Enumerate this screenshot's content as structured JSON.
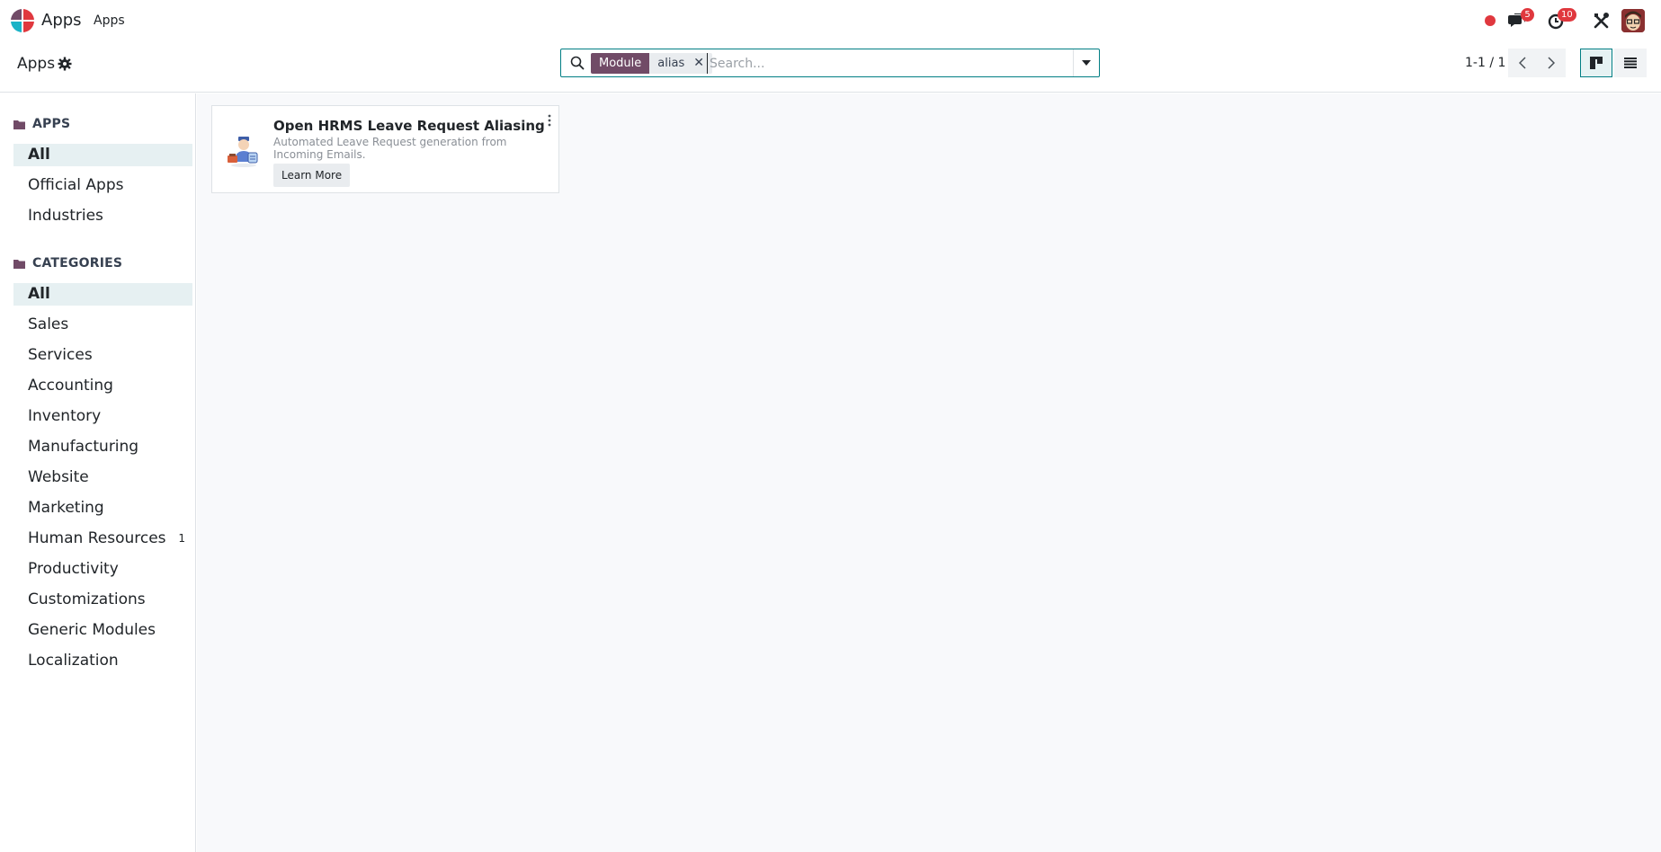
{
  "navbar": {
    "app_title": "Apps",
    "menu_apps": "Apps",
    "messages_count": "5",
    "activities_count": "10"
  },
  "control_panel": {
    "breadcrumb": "Apps",
    "search": {
      "facet_label": "Module",
      "facet_value": "alias",
      "placeholder": "Search..."
    },
    "pager": "1-1 / 1"
  },
  "sidebar": {
    "apps_header": "APPS",
    "apps_items": [
      {
        "label": "All"
      },
      {
        "label": "Official Apps"
      },
      {
        "label": "Industries"
      }
    ],
    "categories_header": "CATEGORIES",
    "category_items": [
      {
        "label": "All"
      },
      {
        "label": "Sales"
      },
      {
        "label": "Services"
      },
      {
        "label": "Accounting"
      },
      {
        "label": "Inventory"
      },
      {
        "label": "Manufacturing"
      },
      {
        "label": "Website"
      },
      {
        "label": "Marketing"
      },
      {
        "label": "Human Resources",
        "count": "1"
      },
      {
        "label": "Productivity"
      },
      {
        "label": "Customizations"
      },
      {
        "label": "Generic Modules"
      },
      {
        "label": "Localization"
      }
    ]
  },
  "cards": [
    {
      "title": "Open HRMS Leave Request Aliasing",
      "description": "Automated Leave Request generation from Incoming Emails.",
      "button": "Learn More"
    }
  ],
  "colors": {
    "brand": "#714b67",
    "accent": "#017e84",
    "badge": "#e0383e"
  },
  "icons": {
    "logo": "odoo-logo-icon",
    "search": "search-icon",
    "settings": "gear-icon",
    "messages": "chat-icon",
    "activities": "clock-icon",
    "debug": "tools-icon",
    "folder": "folder-icon"
  }
}
